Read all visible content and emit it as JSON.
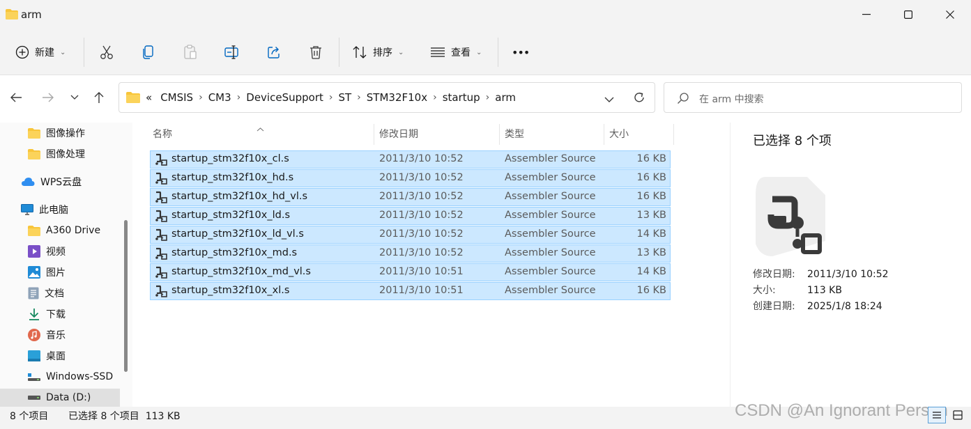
{
  "window": {
    "title": "arm"
  },
  "toolbar": {
    "new_label": "新建",
    "sort_label": "排序",
    "view_label": "查看",
    "more_label": "•••"
  },
  "address": {
    "overflow": "«",
    "crumbs": [
      "CMSIS",
      "CM3",
      "DeviceSupport",
      "ST",
      "STM32F10x",
      "startup",
      "arm"
    ]
  },
  "search": {
    "placeholder": "在 arm 中搜索"
  },
  "nav": {
    "items": [
      {
        "label": "图像操作",
        "icon": "folder-icon"
      },
      {
        "label": "图像处理",
        "icon": "folder-icon"
      },
      {
        "label": "WPS云盘",
        "icon": "cloud-icon"
      },
      {
        "label": "此电脑",
        "icon": "computer-icon"
      },
      {
        "label": "A360 Drive",
        "icon": "folder-icon"
      },
      {
        "label": "视频",
        "icon": "video-icon"
      },
      {
        "label": "图片",
        "icon": "picture-icon"
      },
      {
        "label": "文档",
        "icon": "document-icon"
      },
      {
        "label": "下载",
        "icon": "download-icon"
      },
      {
        "label": "音乐",
        "icon": "music-icon"
      },
      {
        "label": "桌面",
        "icon": "desktop-icon"
      },
      {
        "label": "Windows-SSD",
        "icon": "drive-icon"
      },
      {
        "label": "Data (D:)",
        "icon": "drive-icon"
      }
    ]
  },
  "list": {
    "headers": {
      "name": "名称",
      "date": "修改日期",
      "type": "类型",
      "size": "大小"
    },
    "rows": [
      {
        "name": "startup_stm32f10x_cl.s",
        "date": "2011/3/10 10:52",
        "type": "Assembler Source",
        "size": "16 KB"
      },
      {
        "name": "startup_stm32f10x_hd.s",
        "date": "2011/3/10 10:52",
        "type": "Assembler Source",
        "size": "16 KB"
      },
      {
        "name": "startup_stm32f10x_hd_vl.s",
        "date": "2011/3/10 10:52",
        "type": "Assembler Source",
        "size": "16 KB"
      },
      {
        "name": "startup_stm32f10x_ld.s",
        "date": "2011/3/10 10:52",
        "type": "Assembler Source",
        "size": "13 KB"
      },
      {
        "name": "startup_stm32f10x_ld_vl.s",
        "date": "2011/3/10 10:52",
        "type": "Assembler Source",
        "size": "14 KB"
      },
      {
        "name": "startup_stm32f10x_md.s",
        "date": "2011/3/10 10:52",
        "type": "Assembler Source",
        "size": "13 KB"
      },
      {
        "name": "startup_stm32f10x_md_vl.s",
        "date": "2011/3/10 10:51",
        "type": "Assembler Source",
        "size": "14 KB"
      },
      {
        "name": "startup_stm32f10x_xl.s",
        "date": "2011/3/10 10:51",
        "type": "Assembler Source",
        "size": "16 KB"
      }
    ]
  },
  "details": {
    "title": "已选择 8 个项",
    "props": [
      {
        "key": "修改日期:",
        "value": "2011/3/10 10:52"
      },
      {
        "key": "大小:",
        "value": "113 KB"
      },
      {
        "key": "创建日期:",
        "value": "2025/1/8 18:24"
      }
    ]
  },
  "status": {
    "item_count": "8 个项目",
    "selected": "已选择 8 个项目  113 KB"
  },
  "watermark": "CSDN @An Ignorant Person",
  "colors": {
    "selection_fill": "#cce8ff",
    "selection_border": "#99d1ff",
    "folder": "#f8c53a",
    "accent": "#0067c0"
  }
}
